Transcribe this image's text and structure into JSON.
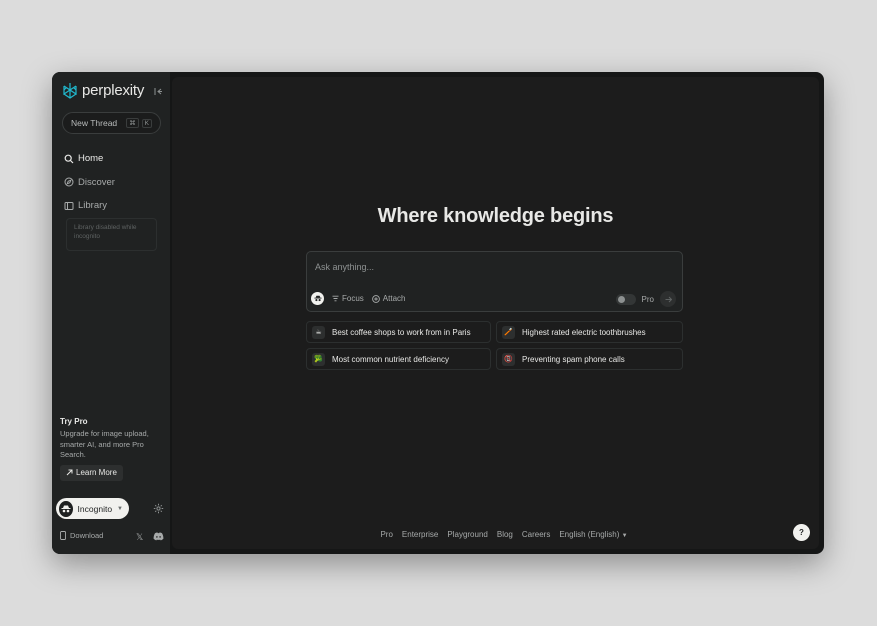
{
  "brand": {
    "name": "perplexity"
  },
  "sidebar": {
    "new_thread": {
      "label": "New Thread",
      "shortcut_mod": "⌘",
      "shortcut_key": "K"
    },
    "nav": [
      {
        "label": "Home",
        "icon": "search-icon"
      },
      {
        "label": "Discover",
        "icon": "compass-icon"
      },
      {
        "label": "Library",
        "icon": "library-icon"
      }
    ],
    "library_disabled": "Library disabled while incognito",
    "try_pro": {
      "title": "Try Pro",
      "description": "Upgrade for image upload, smarter AI, and more Pro Search.",
      "button": "Learn More"
    },
    "incognito_label": "Incognito",
    "download_label": "Download"
  },
  "main": {
    "headline": "Where knowledge begins",
    "ask": {
      "placeholder": "Ask anything...",
      "focus_label": "Focus",
      "attach_label": "Attach",
      "pro_label": "Pro"
    },
    "suggestions": [
      {
        "label": "Best coffee shops to work from in Paris",
        "icon": "☕"
      },
      {
        "label": "Highest rated electric toothbrushes",
        "icon": "🪥"
      },
      {
        "label": "Most common nutrient deficiency",
        "icon": "🥦"
      },
      {
        "label": "Preventing spam phone calls",
        "icon": "📵"
      }
    ],
    "footer_links": [
      "Pro",
      "Enterprise",
      "Playground",
      "Blog",
      "Careers",
      "English (English)"
    ],
    "help_label": "?"
  },
  "colors": {
    "window_bg": "#151616",
    "sidebar_bg": "#202222",
    "main_bg": "#1c1c1c",
    "accent": "#20b8cd",
    "text_primary": "#e8e8e6",
    "text_muted": "#a7aaaa"
  }
}
